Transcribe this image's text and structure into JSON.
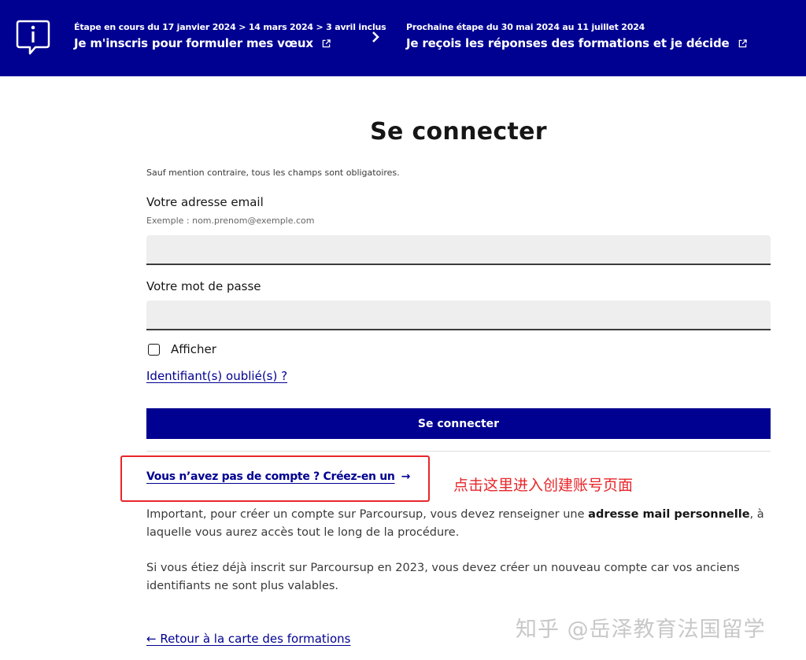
{
  "banner": {
    "current_step_small": "Étape en cours du 17 janvier 2024 > 14 mars 2024 > 3 avril inclus",
    "current_step_title": "Je m'inscris pour formuler mes vœux",
    "next_step_small": "Prochaine étape du 30 mai 2024 au 11 juillet 2024",
    "next_step_title": "Je reçois les réponses des formations et je décide",
    "info_icon": "info-icon",
    "external_icon": "external-link-icon",
    "chevron_icon": "chevron-right-icon"
  },
  "form": {
    "title": "Se connecter",
    "required_hint": "Sauf mention contraire, tous les champs sont obligatoires.",
    "email_label": "Votre adresse email",
    "email_hint": "Exemple : nom.prenom@exemple.com",
    "email_value": "",
    "password_label": "Votre mot de passe",
    "password_value": "",
    "show_password_label": "Afficher",
    "show_password_checked": false,
    "forgot_link": "Identifiant(s) oublié(s) ?",
    "submit_label": "Se connecter"
  },
  "account": {
    "create_link": "Vous n’avez pas de compte ? Créez-en un",
    "arrow": "→",
    "important_before": "Important, pour créer un compte sur Parcoursup, vous devez renseigner une ",
    "important_bold": "adresse mail personnelle",
    "important_after": ", à laquelle vous aurez accès tout le long de la procédure.",
    "notice_2023": "Si vous étiez déjà inscrit sur Parcoursup en 2023, vous devez créer un nouveau compte car vos anciens identifiants ne sont plus valables."
  },
  "footer": {
    "back_arrow": "←",
    "back_link": "Retour à la carte des formations"
  },
  "annotation": {
    "note": "点击这里进入创建账号页面",
    "color": "#e8262a"
  },
  "watermark": "知乎 @岳泽教育法国留学",
  "colors": {
    "brand": "#000091",
    "field_bg": "#eeeeee"
  }
}
